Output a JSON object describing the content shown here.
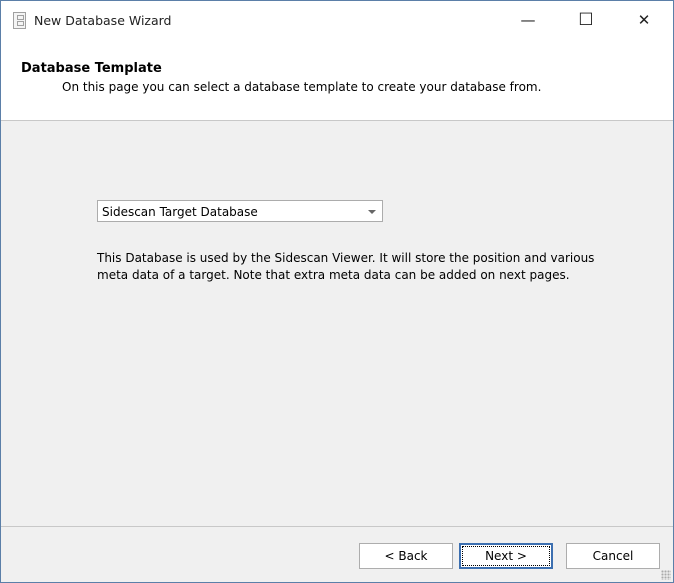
{
  "window": {
    "title": "New Database Wizard",
    "minimize": "—",
    "maximize": "☐",
    "close": "✕"
  },
  "header": {
    "title": "Database Template",
    "subtitle": "On this page you can select a database template to create your database from."
  },
  "template_select": {
    "value": "Sidescan Target Database"
  },
  "description_lines": [
    "This Database is used by the Sidescan Viewer. It will store the position and various",
    "meta data of a target. Note that extra meta data can be added on next pages."
  ],
  "buttons": {
    "back": "< Back",
    "next": "Next >",
    "cancel": "Cancel"
  }
}
